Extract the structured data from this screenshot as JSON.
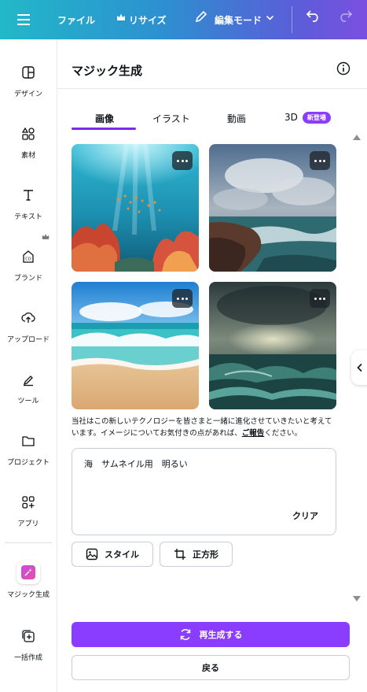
{
  "topbar": {
    "file": "ファイル",
    "resize": "リサイズ",
    "edit_mode": "編集モード"
  },
  "sidebar": {
    "items": [
      {
        "label": "デザイン",
        "icon": "layout-icon"
      },
      {
        "label": "素材",
        "icon": "elements-icon"
      },
      {
        "label": "テキスト",
        "icon": "text-icon"
      },
      {
        "label": "ブランド",
        "icon": "brand-icon"
      },
      {
        "label": "アップロード",
        "icon": "upload-icon"
      },
      {
        "label": "ツール",
        "icon": "draw-icon"
      },
      {
        "label": "プロジェクト",
        "icon": "folder-icon"
      },
      {
        "label": "アプリ",
        "icon": "apps-icon"
      },
      {
        "label": "マジック生成",
        "icon": "magic-media-icon"
      },
      {
        "label": "一括作成",
        "icon": "bulk-create-icon"
      }
    ]
  },
  "panel": {
    "title": "マジック生成",
    "tabs": [
      {
        "label": "画像"
      },
      {
        "label": "イラスト"
      },
      {
        "label": "動画"
      },
      {
        "label": "3D",
        "badge": "新登場"
      }
    ],
    "disclaimer_prefix": "当社はこの新しいテクノロジーを皆さまと一緒に進化させていきたいと考えています。イメージについてお気付きの点があれば、",
    "disclaimer_link": "ご報告",
    "disclaimer_suffix": "ください。",
    "prompt_value": "海　サムネイル用　明るい",
    "clear_label": "クリア",
    "style_label": "スタイル",
    "aspect_label": "正方形",
    "regenerate_label": "再生成する",
    "back_label": "戻る"
  },
  "colors": {
    "accent": "#8b3dff",
    "tab_underline": "#7d2ae8"
  }
}
